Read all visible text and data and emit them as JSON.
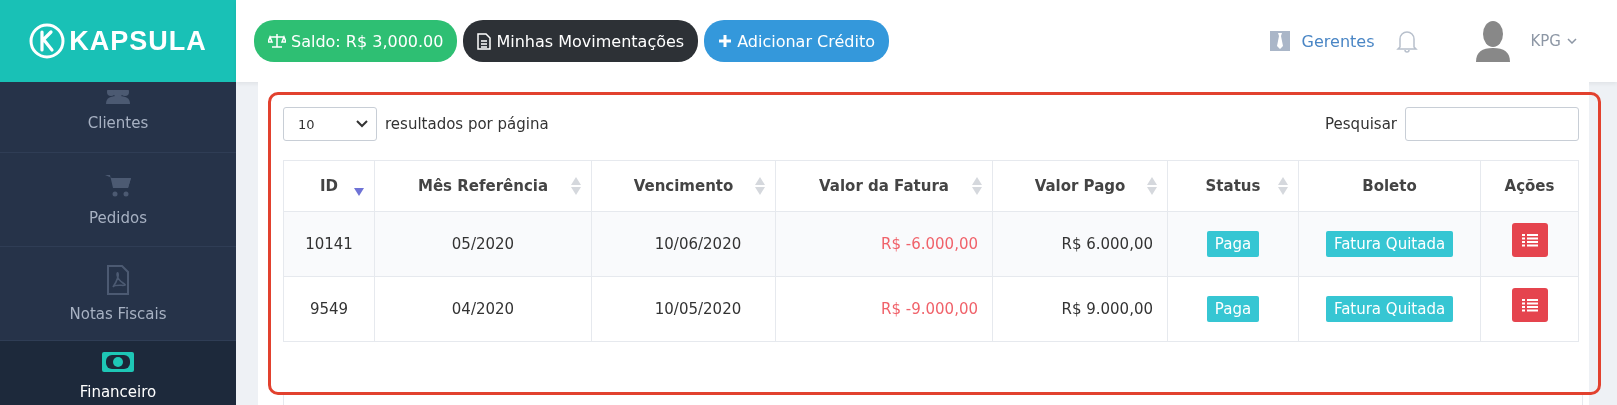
{
  "brand": {
    "name": "KAPSULA"
  },
  "toolbar": [
    {
      "kind": "balance",
      "label": "Saldo: R$ 3,000.00"
    },
    {
      "kind": "statement",
      "label": "Minhas Movimentações"
    },
    {
      "kind": "add",
      "label": "Adicionar Crédito"
    }
  ],
  "user_menu": {
    "managers": "Gerentes",
    "user": "KPG"
  },
  "sidebar": {
    "items": [
      {
        "label": "Clientes",
        "selected": false
      },
      {
        "label": "Pedidos",
        "selected": false
      },
      {
        "label": "Notas Fiscais",
        "selected": false
      },
      {
        "label": "Financeiro",
        "selected": true
      }
    ]
  },
  "table_panel": {
    "highlighted": true,
    "page_size": "10",
    "page_size_label": "resultados por página",
    "search_label": "Pesquisar",
    "columns": [
      {
        "label": "ID",
        "sortable": true,
        "sorted_desc": true
      },
      {
        "label": "Mês Referência",
        "sortable": true,
        "sorted_desc": false
      },
      {
        "label": "Vencimento",
        "sortable": true,
        "sorted_desc": false
      },
      {
        "label": "Valor da Fatura",
        "sortable": true,
        "sorted_desc": false
      },
      {
        "label": "Valor Pago",
        "sortable": true,
        "sorted_desc": false
      },
      {
        "label": "Status",
        "sortable": true,
        "sorted_desc": false
      },
      {
        "label": "Boleto",
        "sortable": false
      },
      {
        "label": "Ações",
        "sortable": false
      }
    ],
    "rows": [
      {
        "id": "10141",
        "month": "05/2020",
        "due": "10/06/2020",
        "invoice_value": "R$ -6.000,00",
        "paid_value": "R$ 6.000,00",
        "status": "Paga",
        "boleto": "Fatura Quitada"
      },
      {
        "id": "9549",
        "month": "04/2020",
        "due": "10/05/2020",
        "invoice_value": "R$ -9.000,00",
        "paid_value": "R$ 9.000,00",
        "status": "Paga",
        "boleto": "Fatura Quitada"
      }
    ]
  }
}
